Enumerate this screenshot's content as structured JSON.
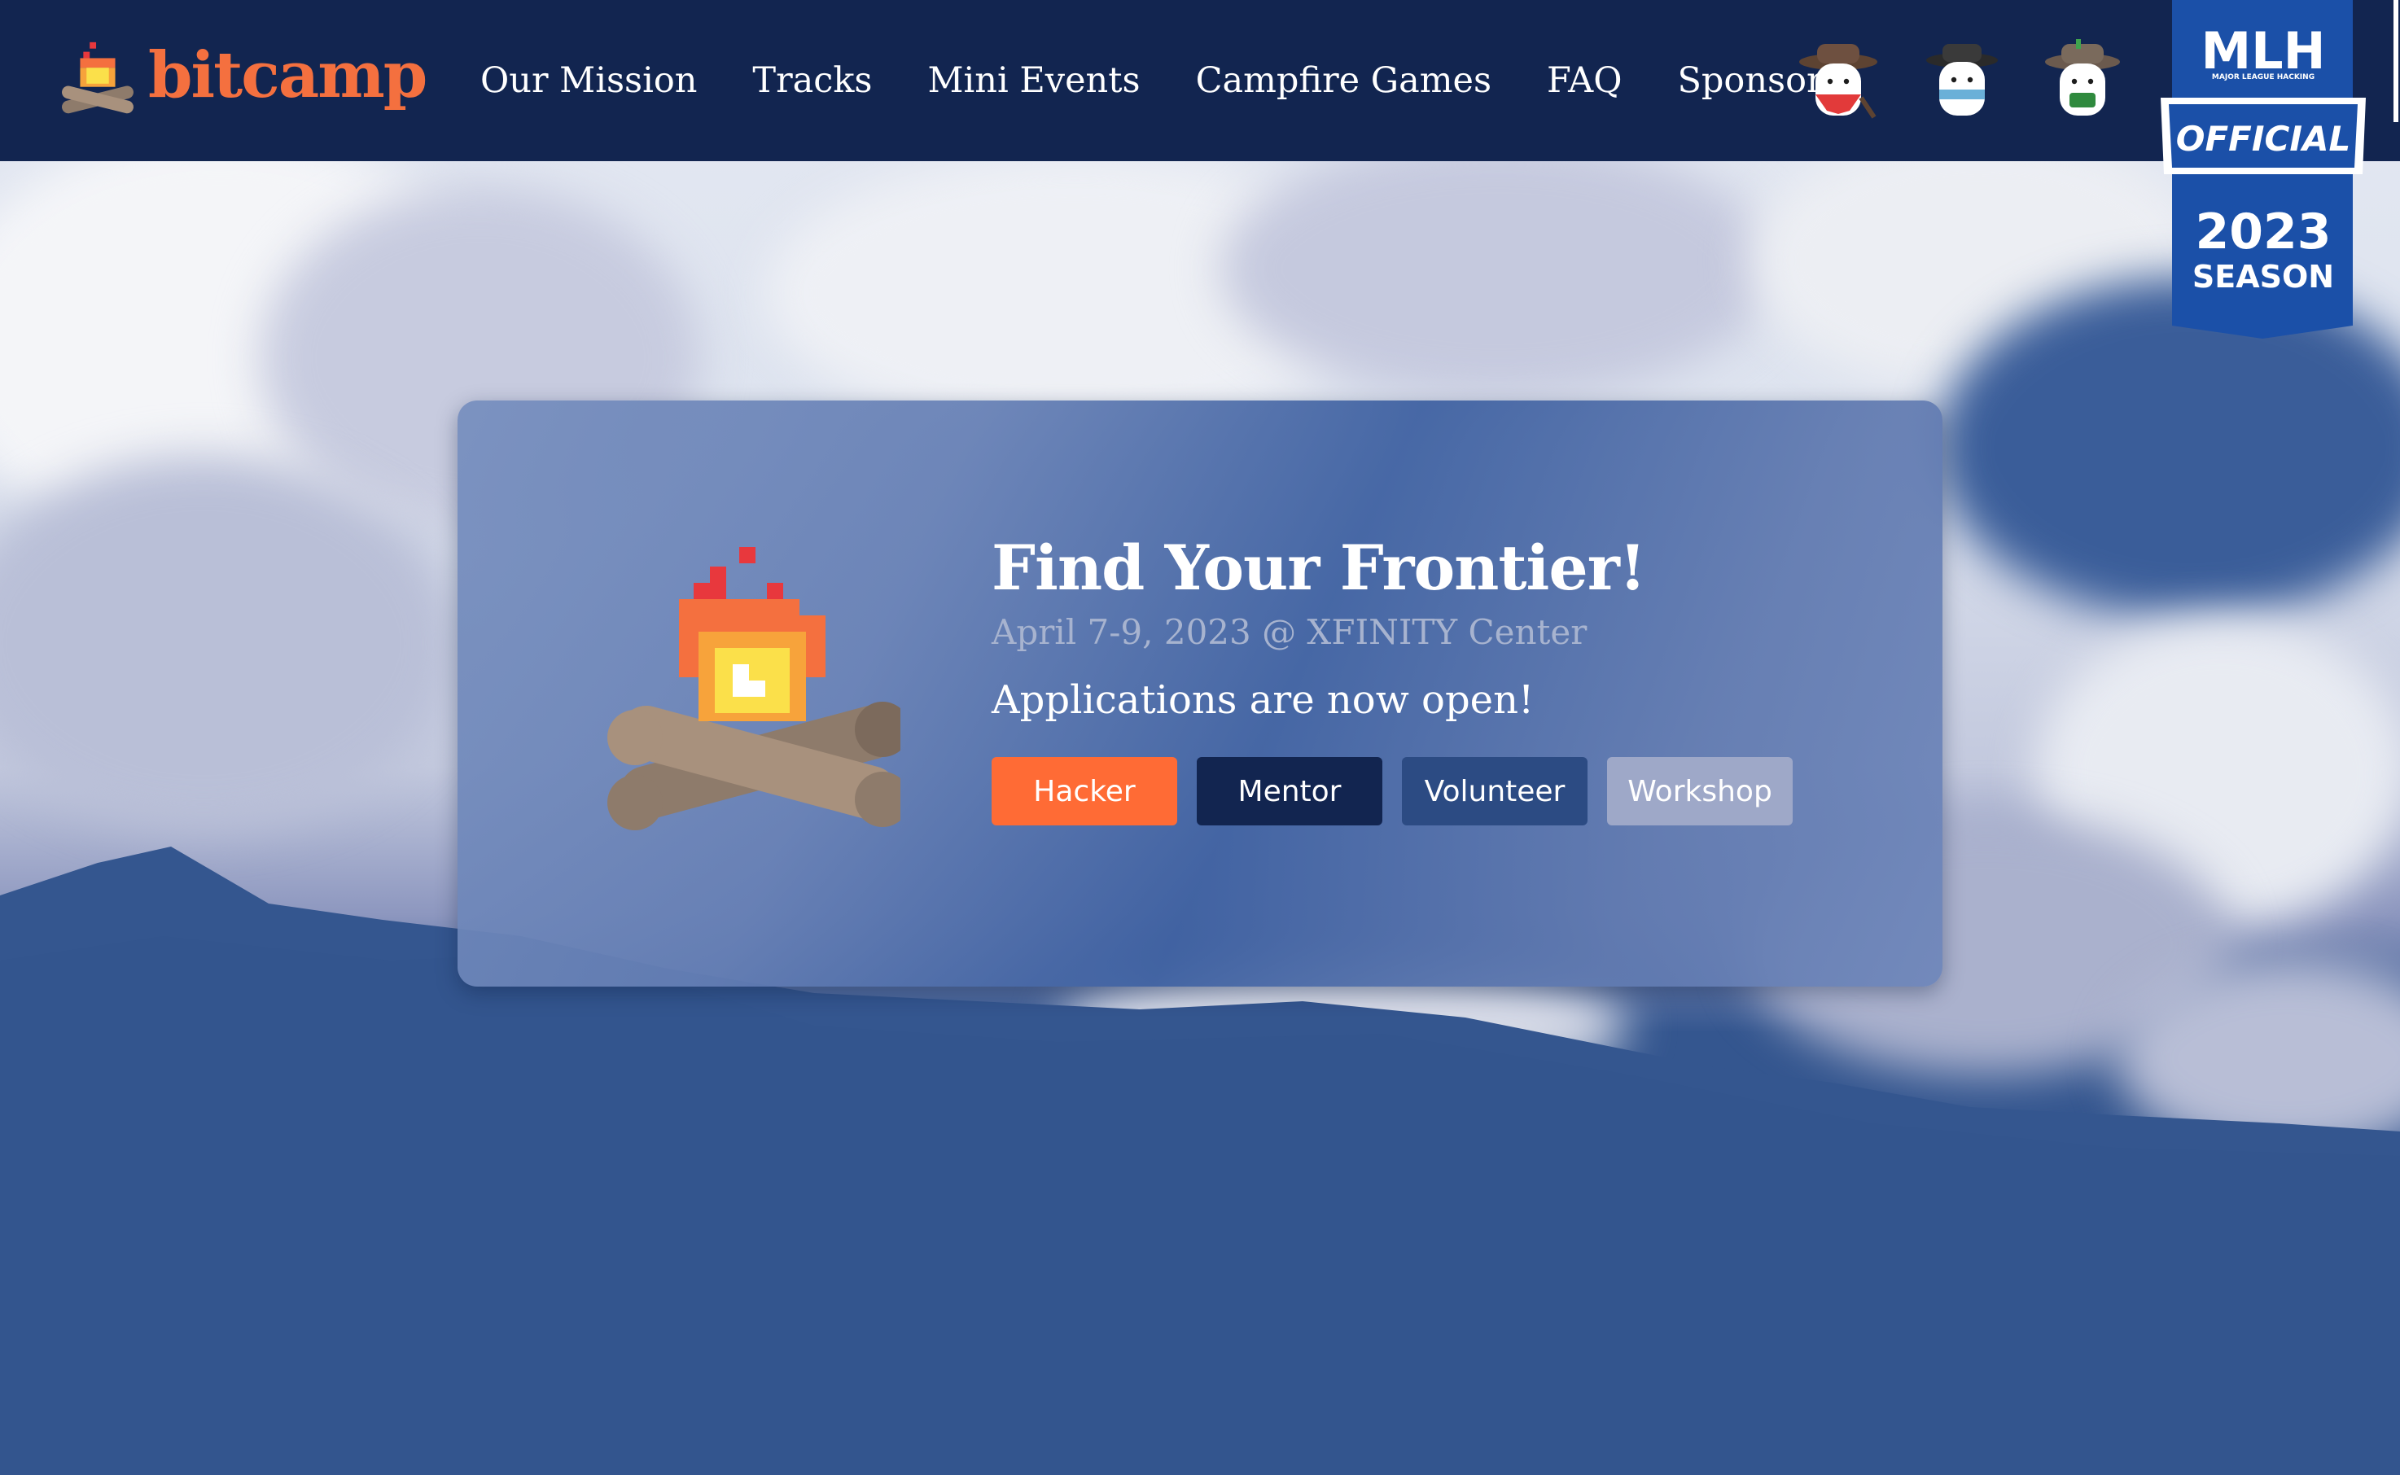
{
  "brand": {
    "name": "bitcamp",
    "logo_icon": "campfire-icon",
    "color": "#f4703f"
  },
  "nav": {
    "links": [
      "Our Mission",
      "Tracks",
      "Mini Events",
      "Campfire Games",
      "FAQ",
      "Sponsors"
    ],
    "avatars": [
      "marshmallow-cowboy-red-bandana-icon",
      "marshmallow-sheriff-blue-bandana-icon",
      "marshmallow-ranger-green-icon"
    ]
  },
  "mlh_badge": {
    "logo": "MLH",
    "tagline": "MAJOR LEAGUE HACKING",
    "ribbon": "OFFICIAL",
    "year": "2023",
    "season": "SEASON"
  },
  "hero": {
    "title": "Find Your Frontier!",
    "date_location": "April 7-9, 2023 @ XFINITY Center",
    "status": "Applications are now open!",
    "art_icon": "pixel-campfire-icon",
    "buttons": [
      {
        "label": "Hacker",
        "color": "#ff6b35"
      },
      {
        "label": "Mentor",
        "color": "#122550"
      },
      {
        "label": "Volunteer",
        "color": "#2c4b83"
      },
      {
        "label": "Workshop",
        "color": "#9ea8c8"
      }
    ]
  },
  "colors": {
    "navbar": "#122550",
    "accent": "#f4703f",
    "mountain": "#34568f"
  }
}
